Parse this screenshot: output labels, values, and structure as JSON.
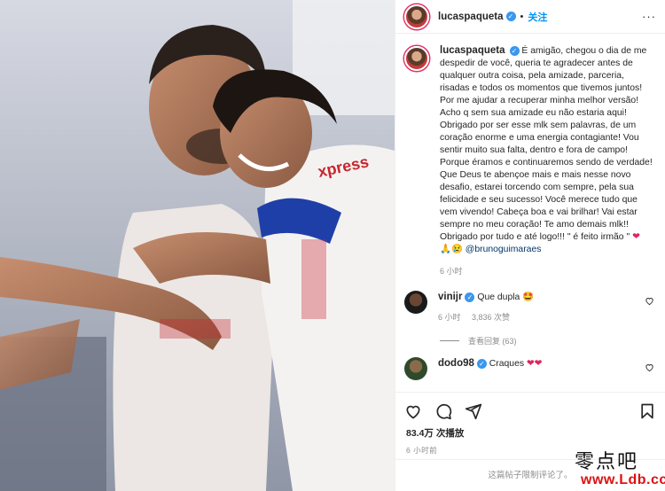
{
  "post": {
    "username": "lucaspaqueta",
    "follow_label": "关注",
    "separator": "•",
    "more_label": "···",
    "caption_text": "É amigão, chegou o dia de me despedir de você, queria te agradecer antes de qualquer outra coisa, pela amizade, parceria, risadas e todos os momentos que tivemos juntos! Por me ajudar a recuperar minha melhor versão! Acho q sem sua amizade eu não estaria aqui!\nObrigado por ser esse mlk sem palavras, de um coração enorme e uma energia contagiante! Vou sentir muito sua falta, dentro e fora de campo! Porque éramos e continuaremos sendo de verdade! Que Deus te abençoe mais e mais nesse novo desafio, estarei torcendo com sempre, pela sua felicidade e seu sucesso! Você merece tudo que vem vivendo! Cabeça boa e vai brilhar! Vai estar sempre no meu coração! Te amo demais mlk!! Obrigado por tudo e até logo!!! \" é feito irmão \"",
    "caption_heart": "❤",
    "caption_emojis": "🙏😢",
    "mention": "@brunoguimaraes",
    "time": "6 小时",
    "verified_mark": "✓"
  },
  "comments": [
    {
      "username": "vinijr",
      "text": "Que dupla",
      "emoji": "🤩",
      "time": "6 小时",
      "likes": "3,836 次赞",
      "replies_label": "查看回复 (63)"
    },
    {
      "username": "dodo98",
      "text": "Craques",
      "emoji": "❤❤",
      "time": "",
      "likes": ""
    }
  ],
  "footer": {
    "views": "83.4万 次播放",
    "ago": "6 小时前",
    "comments_limited": "这篇帖子限制评论了。"
  },
  "photo": {
    "jersey_text": "xpress"
  },
  "watermark": {
    "line1": "零点吧",
    "line2": "www.Ldb.cc"
  },
  "colors": {
    "follow_blue": "#0095f6",
    "verified_blue": "#3897f0",
    "heart_red": "#e0245e",
    "mention": "#00376b"
  },
  "icons": {
    "like": "heart-outline-icon",
    "comment": "speech-bubble-icon",
    "share": "paper-plane-icon",
    "save": "bookmark-icon",
    "more": "ellipsis-icon"
  }
}
